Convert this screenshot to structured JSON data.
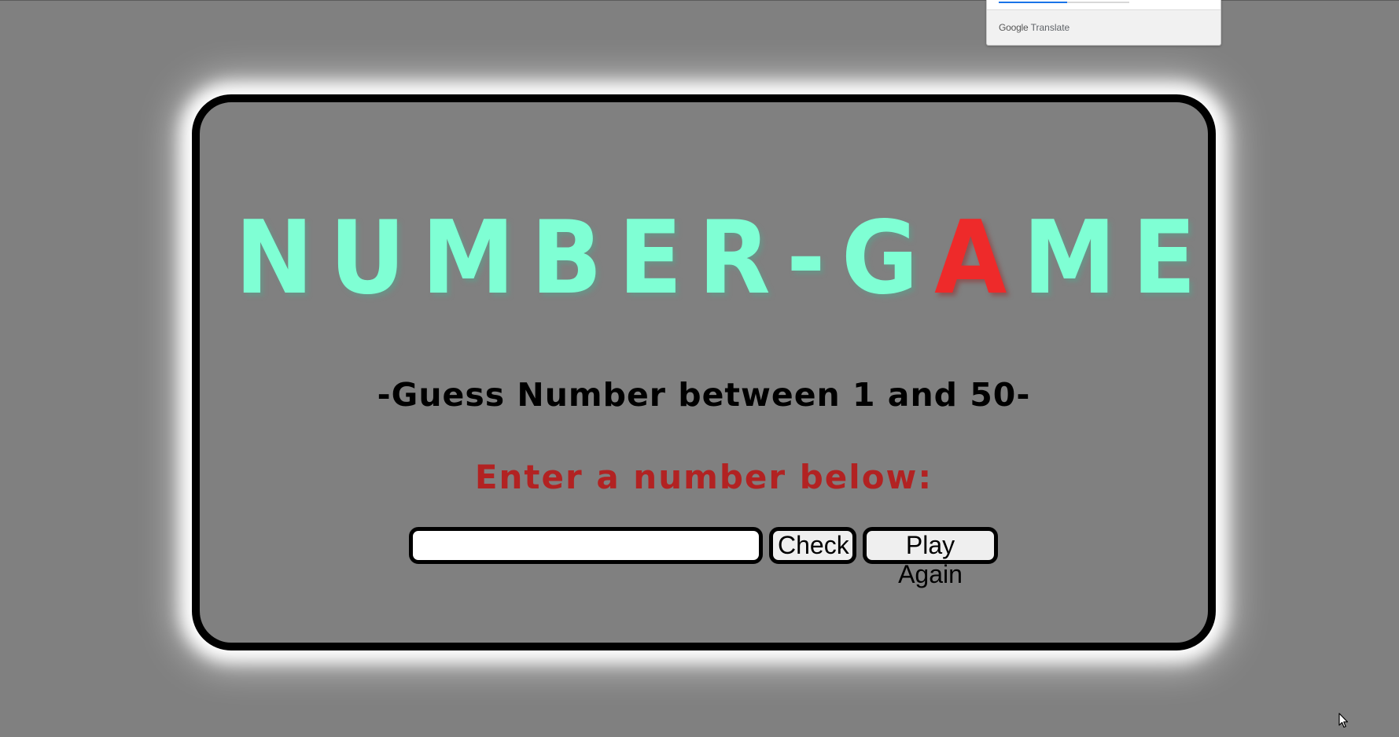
{
  "translate_popup": {
    "brand_google": "Google",
    "brand_translate": "Translate"
  },
  "game": {
    "title_before": "NUMBER-G",
    "title_accent": "A",
    "title_after": "ME",
    "subtitle": "-Guess Number between 1 and 50-",
    "prompt": "Enter a number below:",
    "guess_input": {
      "value": "",
      "placeholder": ""
    },
    "check_label": "Check",
    "play_again_label": "Play Again"
  },
  "colors": {
    "background": "#808080",
    "title": "#7fffd4",
    "title_accent": "#ee2a2a",
    "prompt": "#b22222",
    "card_border": "#000000",
    "card_glow": "#ffffff"
  },
  "icons": {
    "cursor": "mouse-pointer-icon"
  }
}
